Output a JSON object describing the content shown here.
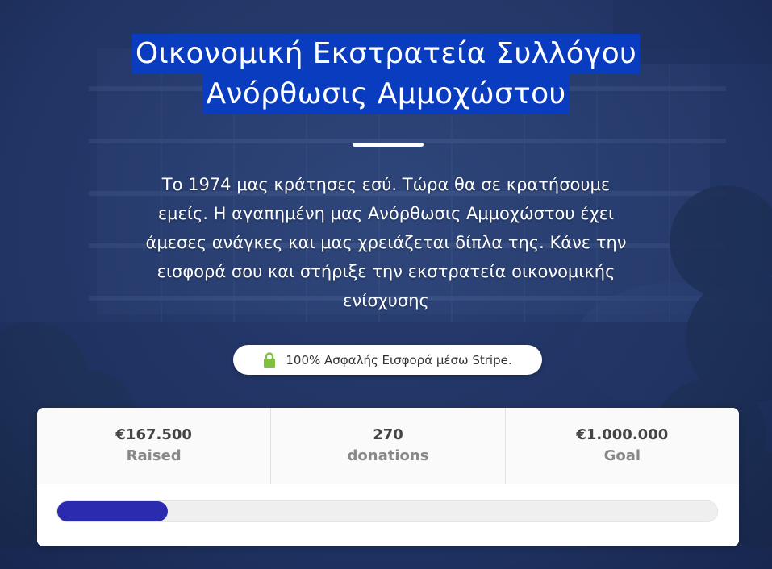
{
  "campaign": {
    "title_line1": "Οικονομική Εκστρατεία Συλλόγου",
    "title_line2": "Ανόρθωσις Αμμοχώστου",
    "description": "Το 1974 μας κράτησες εσύ. Τώρα θα σε κρατήσουμε εμείς. Η αγαπημένη μας Ανόρθωσις Αμμοχώστου έχει άμεσες ανάγκες και μας χρειάζεται δίπλα της. Κάνε την εισφορά σου και στήριξε την εκστρατεία οικονομικής ενίσχυσης",
    "secure_badge": "100% Ασφαλής Εισφορά μέσω Stripe."
  },
  "stats": {
    "raised_value": "€167.500",
    "raised_label": "Raised",
    "donations_value": "270",
    "donations_label": "donations",
    "goal_value": "€1.000.000",
    "goal_label": "Goal"
  },
  "progress": {
    "fraction": 0.1675
  },
  "colors": {
    "title_highlight": "#0a3cbf",
    "progress_fill": "#2b2bb0",
    "lock_icon": "#7dc23a"
  },
  "icons": {
    "secure": "lock-icon"
  }
}
